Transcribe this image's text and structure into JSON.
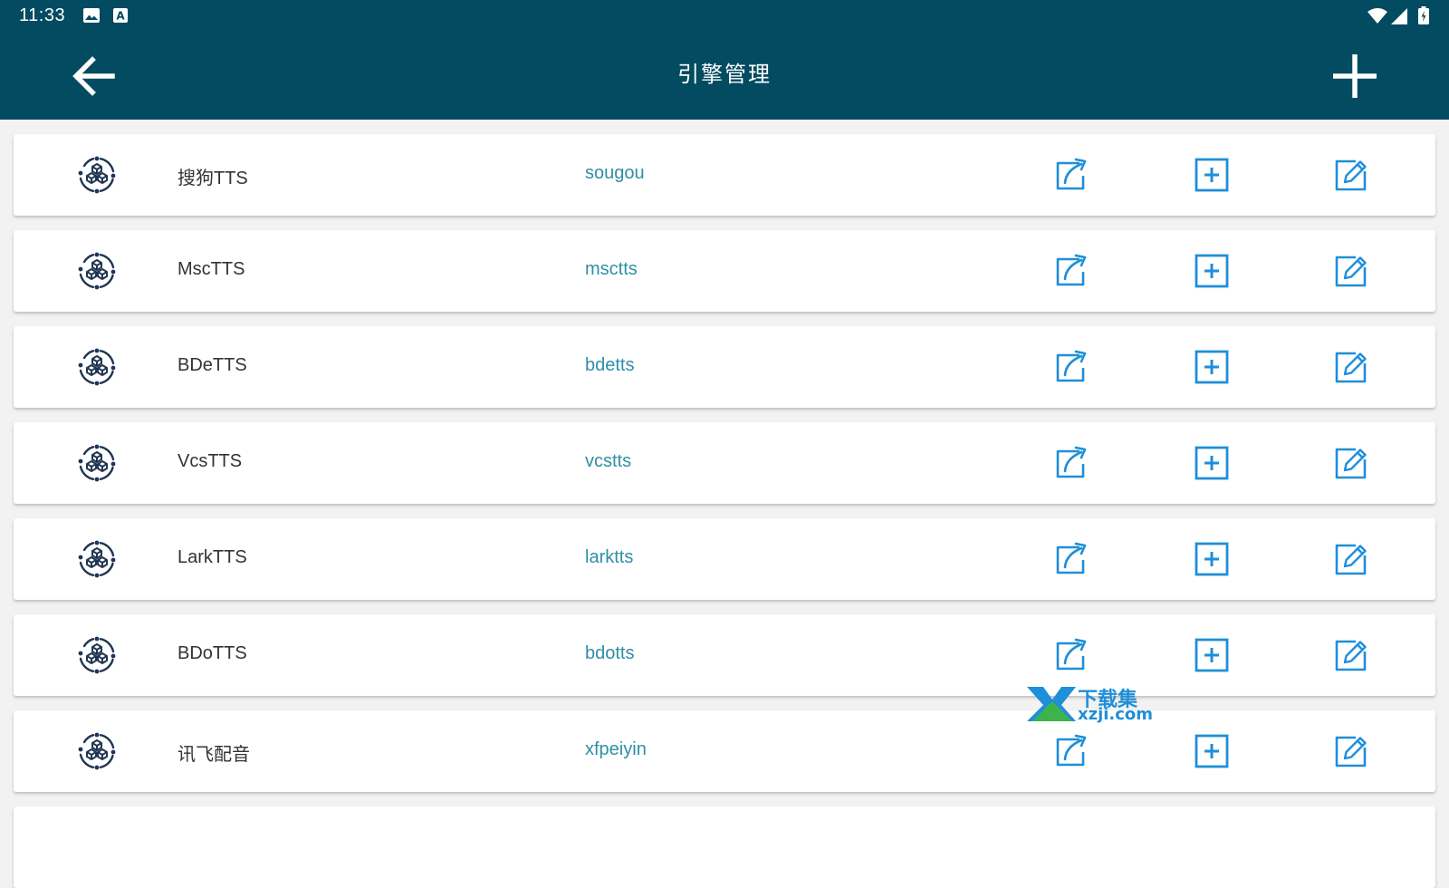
{
  "status_bar": {
    "time": "11:33",
    "icons": [
      "image-icon",
      "a-badge-icon",
      "wifi-icon",
      "signal-icon",
      "battery-icon"
    ]
  },
  "toolbar": {
    "title": "引擎管理",
    "back_icon": "arrow-left-icon",
    "add_icon": "plus-icon"
  },
  "engines": [
    {
      "name": "搜狗TTS",
      "id": "sougou"
    },
    {
      "name": "MscTTS",
      "id": "msctts"
    },
    {
      "name": "BDeTTS",
      "id": "bdetts"
    },
    {
      "name": "VcsTTS",
      "id": "vcstts"
    },
    {
      "name": "LarkTTS",
      "id": "larktts"
    },
    {
      "name": "BDoTTS",
      "id": "bdotts"
    },
    {
      "name": "讯飞配音",
      "id": "xfpeiyin"
    }
  ],
  "row_actions": [
    "share-icon",
    "plus-box-icon",
    "edit-icon"
  ],
  "watermark": {
    "cn": "下载集",
    "en": "xzji.com"
  },
  "colors": {
    "appbar": "#024b61",
    "accent": "#1e8fd8",
    "engine_id_text": "#2f8fa6",
    "engine_icon": "#1f3552",
    "background": "#f2f2f2"
  }
}
